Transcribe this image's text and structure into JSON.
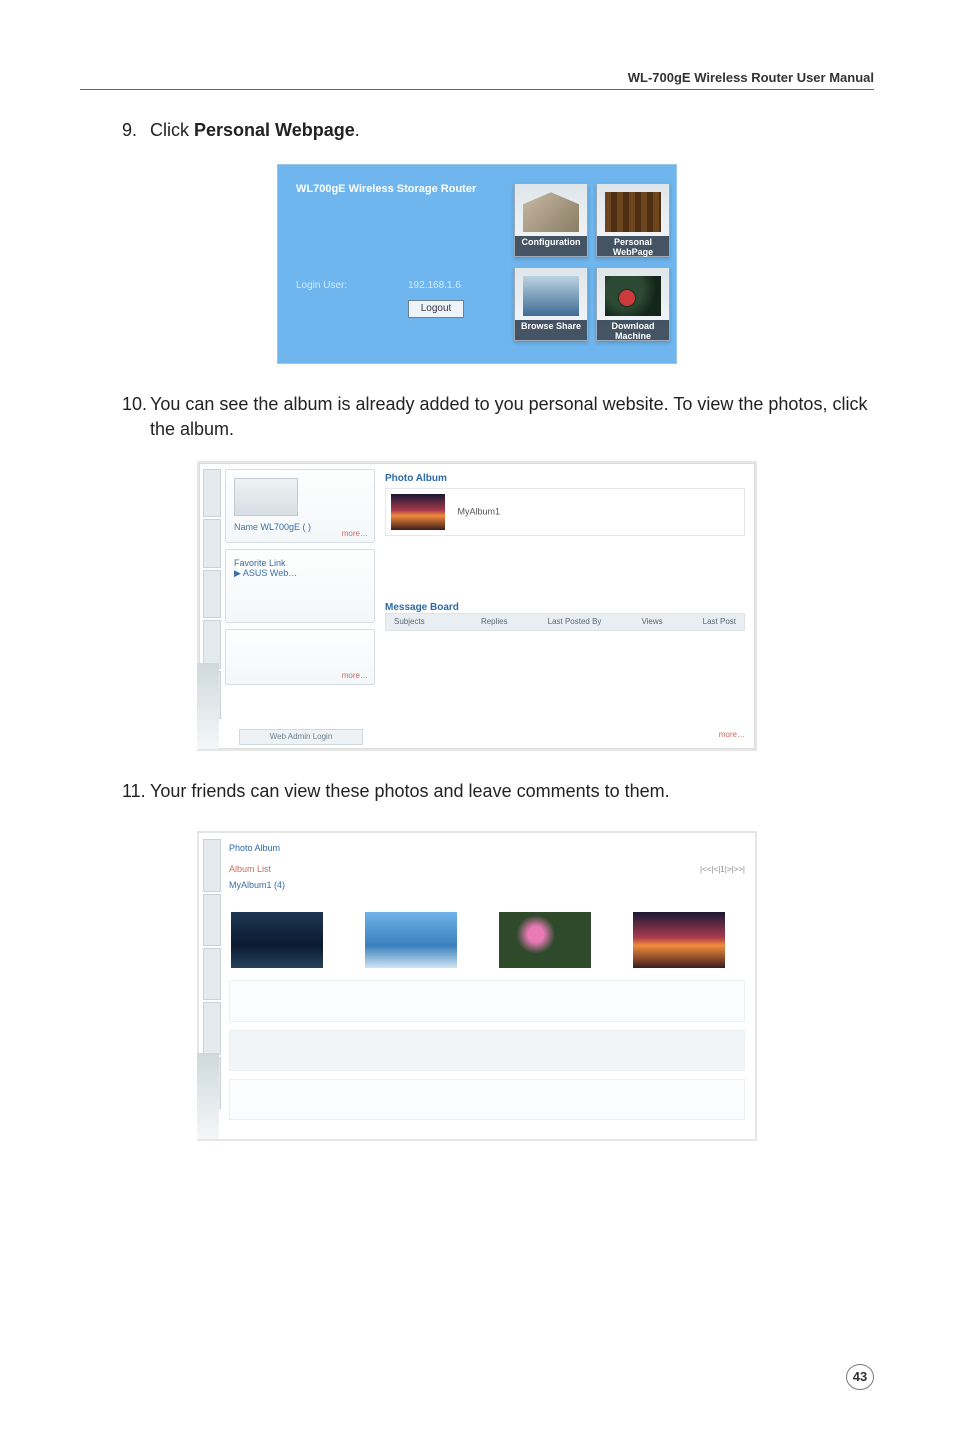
{
  "header": {
    "title": "WL-700gE Wireless Router User Manual"
  },
  "step9": {
    "num": "9.",
    "prefix": "Click ",
    "bold": "Personal Webpage",
    "suffix": "."
  },
  "screenshot1": {
    "title": "WL700gE Wireless Storage Router",
    "login_user_label": "Login User:",
    "ip": "192.168.1.6",
    "logout": "Logout",
    "tiles": {
      "config": "Configuration",
      "personal": "Personal WebPage",
      "browse": "Browse Share",
      "download": "Download Machine"
    }
  },
  "step10": {
    "num": "10.",
    "text": "You can see the album is already added to you personal website. To view the photos, click the album."
  },
  "screenshot2": {
    "photo_album_label": "Photo Album",
    "album_name": "MyAlbum1",
    "card_name_label": "Name",
    "card_name_value": "WL700gE ( )",
    "more": "more…",
    "card2_line1": "Favorite Link",
    "card2_line2": "▶ ASUS Web…",
    "board_label": "Message Board",
    "board_cols": {
      "subject": "Subjects",
      "replies": "Replies",
      "lastpostby": "Last Posted By",
      "views": "Views",
      "lastpost": "Last Post"
    },
    "foot_more": "more…",
    "card3_more": "more…",
    "admin_login": "Web Admin Login"
  },
  "step11": {
    "num": "11.",
    "text": "Your friends can view these photos and leave comments to them."
  },
  "screenshot3": {
    "section": "Photo Album",
    "breadcrumb": "Album List",
    "nav": "|<<|<|1|>|>>|",
    "album_title": "MyAlbum1 (4)"
  },
  "page_number": "43"
}
